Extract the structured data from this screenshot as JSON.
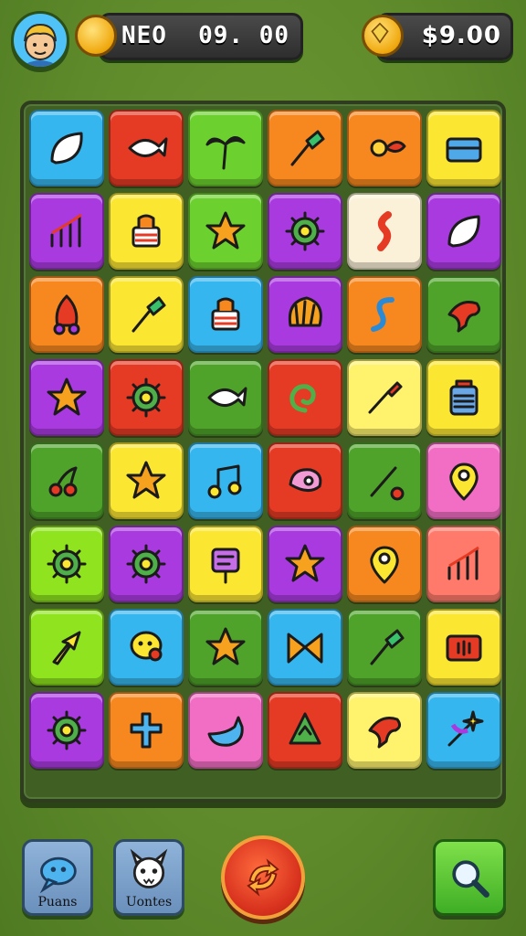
{
  "hud": {
    "player_name": "NEO",
    "score": "09. 00",
    "money": "$9.00"
  },
  "controls": {
    "left_button_label": "Puans",
    "middle_button_label": "Uontes"
  },
  "tile_colors": {
    "blue": "#36b6ee",
    "red": "#e53a23",
    "green": "#6cd12f",
    "orange": "#f7881f",
    "yellow": "#fbe632",
    "purple": "#a93ae0",
    "cream": "#fbf1d8",
    "pink": "#f26dc4",
    "lime": "#8fe41f",
    "darkgreen": "#4fa32a",
    "lightyellow": "#fff36d",
    "salmon": "#ff7a6a"
  },
  "board": {
    "rows": [
      [
        {
          "c": "blue",
          "i": "leaf-icon"
        },
        {
          "c": "red",
          "i": "fish-icon"
        },
        {
          "c": "green",
          "i": "palm-tree-icon"
        },
        {
          "c": "orange",
          "i": "shovel-icon"
        },
        {
          "c": "orange",
          "i": "sun-icon"
        },
        {
          "c": "yellow",
          "i": "chest-icon"
        }
      ],
      [
        {
          "c": "purple",
          "i": "chart-icon"
        },
        {
          "c": "yellow",
          "i": "cake-icon"
        },
        {
          "c": "green",
          "i": "star-icon"
        },
        {
          "c": "purple",
          "i": "gear-icon"
        },
        {
          "c": "cream",
          "i": "wave-icon"
        },
        {
          "c": "purple",
          "i": "leaf-icon"
        }
      ],
      [
        {
          "c": "orange",
          "i": "rocket-icon"
        },
        {
          "c": "yellow",
          "i": "shovel-icon"
        },
        {
          "c": "blue",
          "i": "cake-icon"
        },
        {
          "c": "purple",
          "i": "shell-icon"
        },
        {
          "c": "orange",
          "i": "snake-icon"
        },
        {
          "c": "darkgreen",
          "i": "bird-icon"
        }
      ],
      [
        {
          "c": "purple",
          "i": "star-icon"
        },
        {
          "c": "red",
          "i": "gear-icon"
        },
        {
          "c": "darkgreen",
          "i": "fish-icon"
        },
        {
          "c": "red",
          "i": "swirl-icon"
        },
        {
          "c": "lightyellow",
          "i": "brush-icon"
        },
        {
          "c": "yellow",
          "i": "jar-icon"
        }
      ],
      [
        {
          "c": "darkgreen",
          "i": "cherry-icon"
        },
        {
          "c": "yellow",
          "i": "star-icon"
        },
        {
          "c": "blue",
          "i": "music-icon"
        },
        {
          "c": "red",
          "i": "meat-icon"
        },
        {
          "c": "darkgreen",
          "i": "stick-icon"
        },
        {
          "c": "pink",
          "i": "pin-icon"
        }
      ],
      [
        {
          "c": "lime",
          "i": "gear-icon"
        },
        {
          "c": "purple",
          "i": "gear-icon"
        },
        {
          "c": "yellow",
          "i": "sign-icon"
        },
        {
          "c": "purple",
          "i": "star-icon"
        },
        {
          "c": "orange",
          "i": "pin-icon"
        },
        {
          "c": "salmon",
          "i": "chart-icon"
        }
      ],
      [
        {
          "c": "lime",
          "i": "arrow-icon"
        },
        {
          "c": "blue",
          "i": "chat-icon"
        },
        {
          "c": "darkgreen",
          "i": "star-icon"
        },
        {
          "c": "blue",
          "i": "bow-icon"
        },
        {
          "c": "darkgreen",
          "i": "shovel-icon"
        },
        {
          "c": "yellow",
          "i": "radio-icon"
        }
      ],
      [
        {
          "c": "purple",
          "i": "gear-icon"
        },
        {
          "c": "orange",
          "i": "cross-icon"
        },
        {
          "c": "pink",
          "i": "whale-icon"
        },
        {
          "c": "red",
          "i": "tree-icon"
        },
        {
          "c": "lightyellow",
          "i": "bird-icon"
        },
        {
          "c": "blue",
          "i": "wand-icon"
        }
      ]
    ]
  }
}
